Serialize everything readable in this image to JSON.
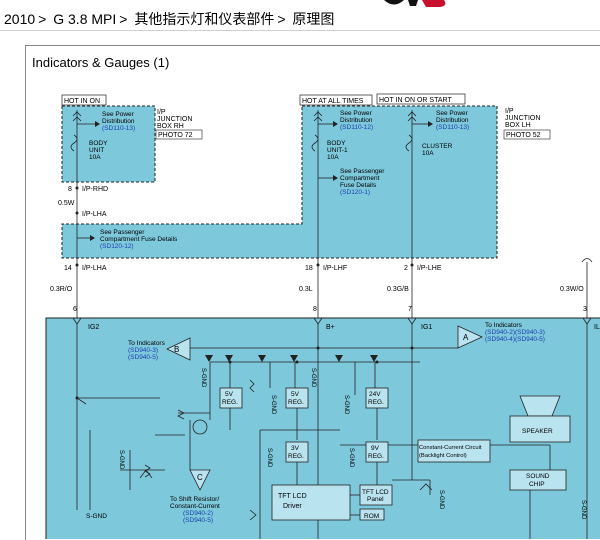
{
  "breadcrumb": {
    "items": [
      "2010",
      "G 3.8 MPI",
      "其他指示灯和仪表部件",
      "原理图"
    ],
    "separator": ">"
  },
  "panel": {
    "title": "Indicators & Gauges (1)"
  },
  "colors": {
    "fill": "#7ec8dc",
    "link": "#1c3fae",
    "logo": "#c8102e"
  },
  "diagram": {
    "hot_in_on": "HOT IN ON",
    "hot_at_all_times": "HOT AT ALL TIMES",
    "hot_in_on_or_start": "HOT IN ON OR START",
    "see_power_1": "See Power",
    "see_power_2": "Distribution",
    "sd110_13": "(SD110-13)",
    "sd110_12": "(SD110-12)",
    "jb_rh_1": "I/P",
    "jb_rh_2": "JUNCTION",
    "jb_rh_3": "BOX RH",
    "photo72": "PHOTO 72",
    "jb_lh_1": "I/P",
    "jb_lh_2": "JUNCTION",
    "jb_lh_3": "BOX LH",
    "photo52": "PHOTO 52",
    "body_unit_1": "BODY",
    "body_unit_2": "UNIT",
    "fuse_10a": "10A",
    "body_unit1_1": "BODY",
    "body_unit1_2": "UNIT-1",
    "cluster": "CLUSTER",
    "see_pass_1": "See Passenger",
    "see_pass_2": "Compartment",
    "see_pass_3": "Fuse Details",
    "sd120_1": "(SD120-1)",
    "see_pass_b1": "See Passenger",
    "see_pass_b2": "Compartment Fuse Details",
    "sd120_12": "(SD120-12)",
    "p8": "8",
    "iprhd": "I/P-RHD",
    "w05": "0.5W",
    "iplha": "I/P-LHA",
    "p14": "14",
    "iplha2": "I/P-LHA",
    "p18": "18",
    "iplhf": "I/P-LHF",
    "p2": "2",
    "iplhe": "I/P-LHE",
    "w03ro": "0.3R/O",
    "w03l": "0.3L",
    "w03gb": "0.3G/B",
    "w03wo": "0.3W/O",
    "c6": "6",
    "c8": "8",
    "c7": "7",
    "c3": "3",
    "ig2": "IG2",
    "bplus": "B+",
    "ig1": "IG1",
    "il": "IL",
    "to_ind_l": "To Indicators",
    "sd940_3": "(SD940-3)",
    "sd940_5": "(SD940-5)",
    "to_ind_r": "To Indicators",
    "sd940_2_3": "(SD940-2)(SD940-3)",
    "sd940_4_5": "(SD940-4)(SD940-5)",
    "tri_b": "B",
    "tri_a": "A",
    "tri_c": "C",
    "reg5v_1": "5V",
    "reg5v_2": "REG.",
    "reg5v2_1": "5V",
    "reg5v2_2": "REG.",
    "reg24_1": "24V",
    "reg24_2": "REG.",
    "reg3v_1": "3V",
    "reg3v_2": "REG.",
    "reg9v_1": "9V",
    "reg9v_2": "REG.",
    "sgnd": "S-GND",
    "cc_1": "Constant-Current Circuit",
    "cc_2": "(Backlight Control)",
    "tft_p1": "TFT LCD",
    "tft_p2": "Panel",
    "tft_d1": "TFT LCD",
    "tft_d2": "Driver",
    "rom": "ROM",
    "speaker": "SPEAKER",
    "sound_1": "SOUND",
    "sound_2": "CHIP",
    "shift_1": "To Shift Resistor/",
    "shift_2": "Constant-Current",
    "sd940_2": "(SD940-2)",
    "sd940_5b": "(SD940-5)"
  }
}
